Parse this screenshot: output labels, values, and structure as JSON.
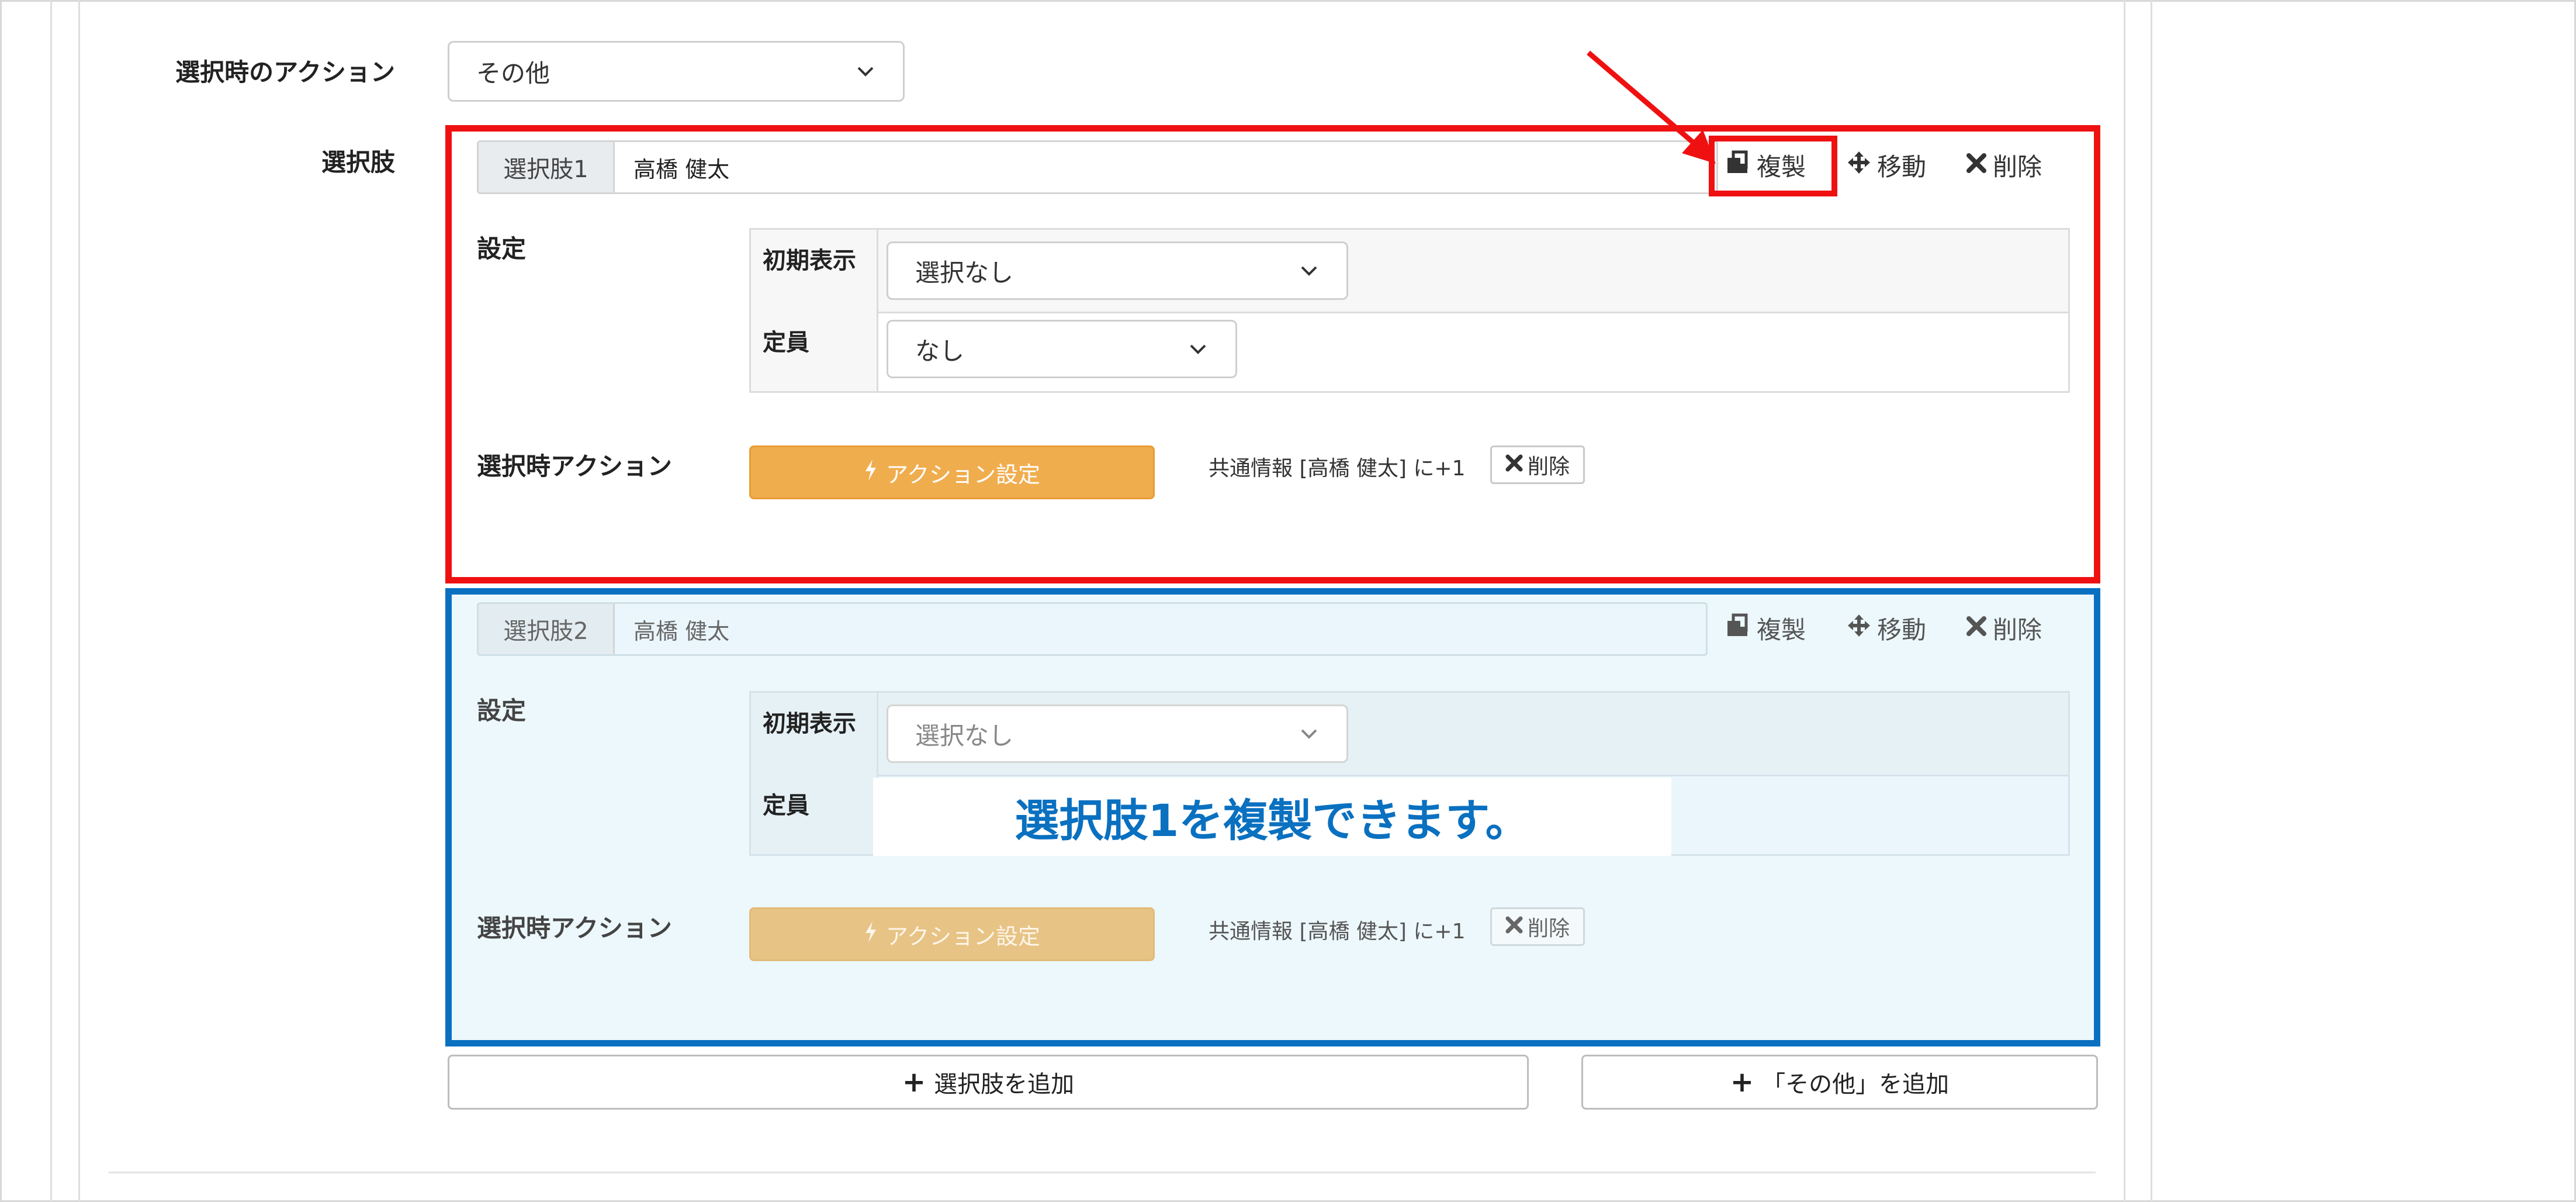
{
  "form": {
    "action_on_select_label": "選択時のアクション",
    "action_on_select_value": "その他",
    "choices_label": "選択肢"
  },
  "choices": [
    {
      "tag": "選択肢1",
      "name": "高橋 健太",
      "toolbar": {
        "duplicate": "複製",
        "move": "移動",
        "delete": "削除"
      },
      "settings_label": "設定",
      "settings": {
        "initial_display_label": "初期表示",
        "initial_display_value": "選択なし",
        "capacity_label": "定員",
        "capacity_value": "なし"
      },
      "select_action_label": "選択時アクション",
      "action_button": "アクション設定",
      "shared_info": "共通情報 [高橋 健太] に+1",
      "shared_delete": "削除"
    },
    {
      "tag": "選択肢2",
      "name": "高橋 健太",
      "toolbar": {
        "duplicate": "複製",
        "move": "移動",
        "delete": "削除"
      },
      "settings_label": "設定",
      "settings": {
        "initial_display_label": "初期表示",
        "initial_display_value": "選択なし",
        "capacity_label": "定員"
      },
      "select_action_label": "選択時アクション",
      "action_button": "アクション設定",
      "shared_info": "共通情報 [高橋 健太] に+1",
      "shared_delete": "削除"
    }
  ],
  "annotation": {
    "note": "選択肢1を複製できます。"
  },
  "footer_buttons": {
    "add_choice": "選択肢を追加",
    "add_other": "「その他」を追加"
  },
  "colors": {
    "highlight_red": "#ef1111",
    "highlight_blue": "#0a70c0",
    "action_orange": "#f0ad4e"
  },
  "icons": {
    "duplicate": "duplicate-icon",
    "move": "move-arrows-icon",
    "delete": "x-icon",
    "action": "lightning-icon",
    "plus": "plus-icon",
    "dropdown": "chevron-down-icon"
  }
}
